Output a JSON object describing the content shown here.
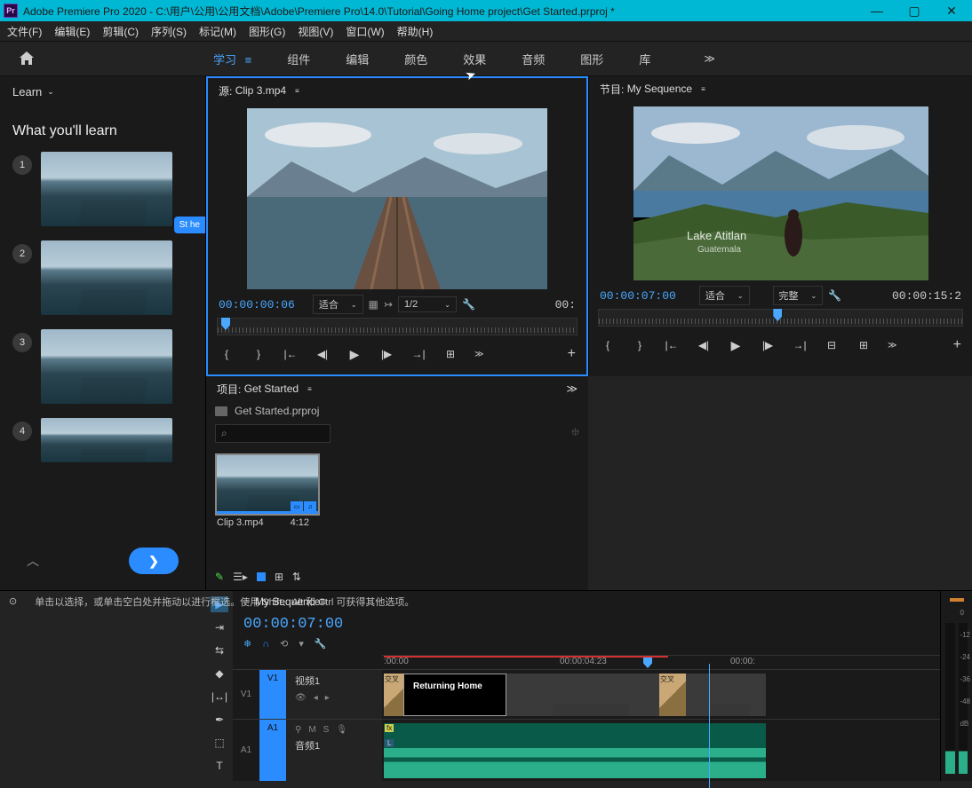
{
  "titlebar": {
    "app_name": "Adobe Premiere Pro 2020",
    "path": "C:\\用户\\公用\\公用文档\\Adobe\\Premiere Pro\\14.0\\Tutorial\\Going Home project\\Get Started.prproj *",
    "pr": "Pr"
  },
  "menu": [
    "文件(F)",
    "编辑(E)",
    "剪辑(C)",
    "序列(S)",
    "标记(M)",
    "图形(G)",
    "视图(V)",
    "窗口(W)",
    "帮助(H)"
  ],
  "workspaces": {
    "items": [
      "学习",
      "组件",
      "编辑",
      "颜色",
      "效果",
      "音频",
      "图形",
      "库"
    ],
    "active_index": 0,
    "overflow": "≫"
  },
  "learn": {
    "tab": "Learn",
    "heading": "What you'll learn",
    "bubble": "St\nhe",
    "steps": [
      "1",
      "2",
      "3",
      "4"
    ]
  },
  "source": {
    "tab_prefix": "源:",
    "clip_name": "Clip 3.mp4",
    "timecode": "00:00:00:06",
    "fit": "适合",
    "resolution": "1/2",
    "duration": "00:"
  },
  "program": {
    "tab_prefix": "节目:",
    "sequence": "My Sequence",
    "timecode": "00:00:07:00",
    "fit": "适合",
    "full": "完整",
    "duration": "00:00:15:2",
    "overlay1": "Lake Atitlan",
    "overlay2": "Guatemala"
  },
  "project": {
    "tab_prefix": "项目:",
    "name": "Get Started",
    "file": "Get Started.prproj",
    "search_icon": "⌕",
    "clip_name": "Clip 3.mp4",
    "clip_dur": "4:12",
    "overflow": "≫"
  },
  "timeline": {
    "sequence": "My Sequence",
    "timecode": "00:00:07:00",
    "ruler": [
      ":00:00",
      "00:00:04:23",
      "00:00:"
    ],
    "v1_patch": "V1",
    "v1": "V1",
    "video_track": "视频1",
    "a1_patch": "A1",
    "a1": "A1",
    "audio_track": "音频1",
    "m": "M",
    "s": "S",
    "dissolve": "交叉",
    "title_clip": "Returning Home",
    "fx": "fx",
    "L": "L"
  },
  "meters": {
    "labels": [
      "0",
      "-12",
      "-24",
      "-36",
      "-48",
      "dB"
    ]
  },
  "status": {
    "text": "单击以选择，或单击空白处并拖动以进行框选。使用 Shift、Alt 和 Ctrl 可获得其他选项。"
  }
}
